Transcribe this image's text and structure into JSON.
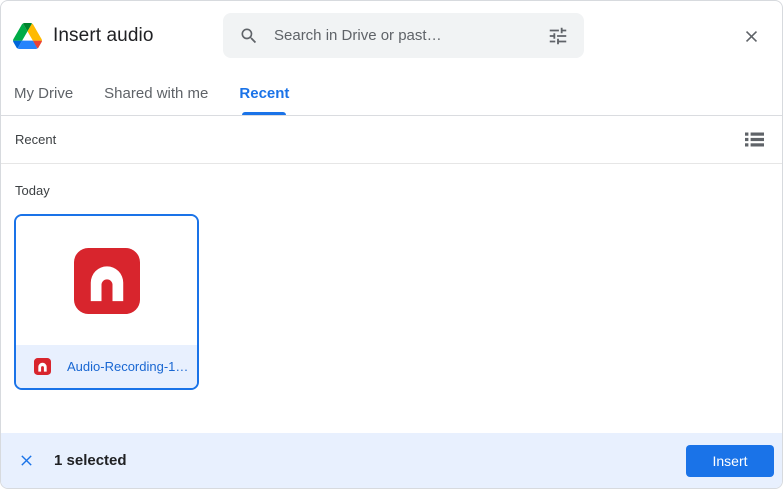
{
  "dialog": {
    "title": "Insert audio"
  },
  "search": {
    "placeholder": "Search in Drive or past…"
  },
  "tabs": [
    {
      "label": "My Drive",
      "active": false
    },
    {
      "label": "Shared with me",
      "active": false
    },
    {
      "label": "Recent",
      "active": true
    }
  ],
  "toolbar": {
    "section_label": "Recent"
  },
  "content": {
    "group_label": "Today",
    "files": [
      {
        "name": "Audio-Recording-1…",
        "type": "audio",
        "selected": true
      }
    ]
  },
  "footer": {
    "selection_text": "1 selected",
    "insert_label": "Insert"
  },
  "icons": {
    "logo": "google-drive-logo",
    "search": "search-icon",
    "filter": "tune-icon",
    "close": "close-icon",
    "view_toggle": "list-view-icon",
    "file": "headphones-icon",
    "deselect": "close-icon"
  },
  "colors": {
    "accent_blue": "#1a73e8",
    "filename_blue": "#1967d2",
    "selection_bg": "#e8f0fe",
    "audio_icon_red": "#d8252d",
    "text_primary": "#202124",
    "text_secondary": "#5f6368",
    "searchbox_bg": "#f1f3f4",
    "divider": "#dadce0"
  }
}
